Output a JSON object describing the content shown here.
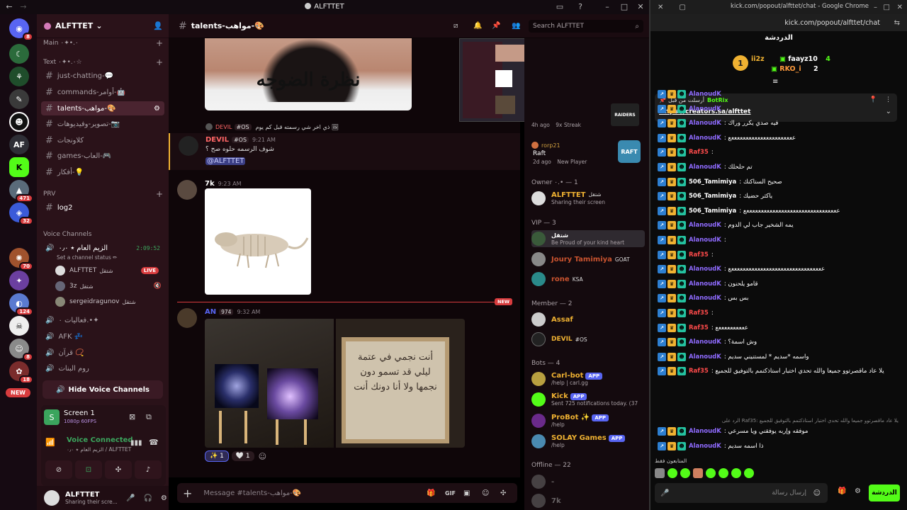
{
  "discord": {
    "window_title": "ALFTTET",
    "server_name": "ALFTTET",
    "guild_badges": [
      "8",
      "471",
      "32",
      "70",
      "124",
      "8",
      "18"
    ],
    "guild_letters": "AF",
    "new_label": "NEW",
    "categories": {
      "main": "Main ٠.•✦٠",
      "text": "Text ٠.•✦٠☆",
      "prv": "PRV",
      "voice": "Voice Channels"
    },
    "channels": [
      {
        "label": "just-chatting-💬"
      },
      {
        "label": "commands-أوامر-🤖"
      },
      {
        "label": "talents-مواهب-🎨"
      },
      {
        "label": "تصوير-وفيديوهات-📷"
      },
      {
        "label": "كلاونجات"
      },
      {
        "label": "games-العاب-🎮"
      },
      {
        "label": "أفكار-💡"
      }
    ],
    "prv_channel": "log2",
    "voice_channel": "الزيم العام ⭑ ۰٫٠",
    "voice_timer": "2:09:52",
    "set_status": "Set a channel status ✏",
    "voice_users": [
      "ALFTTET",
      "3z",
      "sergeidragunov"
    ],
    "voice_tags": [
      "شتقل",
      "شتقل",
      "شتقل"
    ],
    "live_label": "LIVE",
    "other_voice": [
      {
        "label": "فعاليات ٠.•✦"
      },
      {
        "label": "AFK 💤"
      },
      {
        "label": "قرآن 📿"
      },
      {
        "label": "روم البنات"
      }
    ],
    "hide_voice": "Hide Voice Channels",
    "screen_share": {
      "title": "Screen 1",
      "sub": "1080p 60FPS"
    },
    "voice_connected": {
      "title": "Voice Connected",
      "sub": "الزيم العام ⭑ ۰٫٠ / ALFTTET"
    },
    "user": {
      "name": "ALFTTET",
      "status": "Sharing their scre..."
    },
    "chat_channel": "talents-مواهب-🎨",
    "search_placeholder": "Search ALFTTET",
    "messages": {
      "meme_text": "نظرة الضوجه",
      "reply_name": "DEVIL",
      "reply_tag": "#OS",
      "reply_text": "ذي اخر شي رسمته قبل كم يوم 🖼",
      "m1_name": "DEVIL",
      "m1_tag": "#OS",
      "m1_time": "9:21 AM",
      "m1_text": "شوف الرسمه حلوه صح ؟",
      "m1_mention": "@ALFTTET",
      "m2_name": "7k",
      "m2_time": "9:23 AM",
      "m3_name": "AN",
      "m3_tag": "974",
      "m3_time": "9:32 AM",
      "new_label": "NEW",
      "art_text": "أنت نجمي في عتمة ليلي قد تسمو دون نجمها ولا أنا دونك أنت",
      "reaction_1": "✨ 1",
      "reaction_2": "🤍 1"
    },
    "composer_placeholder": "Message #talents-مواهب-🎨",
    "members": {
      "stream_meta_1": "4h ago",
      "stream_meta_2": "9x Streak",
      "activity_name": "rorp21",
      "activity_game": "Raft",
      "activity_meta_1": "2d ago",
      "activity_meta_2": "New Player",
      "owner_cat": "Owner ٠.• — 1",
      "owner_name": "ALFTTET",
      "owner_status": "Sharing their screen",
      "owner_tag": "شتقل",
      "vip_cat": "VIP — 3",
      "vip1_name": "شتقل",
      "vip1_status": "Be Proud of your kind heart",
      "vip2_name": "Joury Tamimiya",
      "vip2_tag": "GOAT",
      "vip3_name": "rone",
      "vip3_tag": "KSA",
      "member_cat": "Member — 2",
      "mem1_name": "Assaf",
      "mem2_name": "DEVIL",
      "mem2_tag": "#OS",
      "bots_cat": "Bots — 4",
      "bot1_name": "Carl-bot",
      "bot1_status": "/help | carl.gg",
      "bot2_name": "Kick",
      "bot2_status": "Sent 725 notifications today. (3755 yo",
      "bot3_name": "ProBot ✨",
      "bot3_status": "/help",
      "bot4_name": "SOLAY Games",
      "bot4_status": "/help",
      "app_label": "APP",
      "offline_cat": "Offline — 22",
      "off1_name": "-",
      "off2_name": "7k"
    }
  },
  "kick": {
    "window_title": "kick.com/popout/alfttet/chat - Google Chrome",
    "url": "kick.com/popout/alfttet/chat",
    "chat_title": "الدردشة",
    "leaders": [
      {
        "name": "ii2z",
        "score": ""
      },
      {
        "name": "faayz10",
        "score": "4"
      },
      {
        "name": "RKO_i",
        "score": "2"
      }
    ],
    "leader_rank": "1",
    "pinned_label": "أرسلت من قبل",
    "pinned_user": "BotRix",
    "pinned_link": "https://creators.sa/alfttet",
    "lines": [
      {
        "user": "AlanoudK",
        "text": "",
        "color": "#8f6bff"
      },
      {
        "user": "AlanoudK",
        "text": "",
        "color": "#8f6bff"
      },
      {
        "user": "AlanoudK",
        "text": ": فيه صدي يكرر وراك",
        "color": "#8f6bff"
      },
      {
        "user": "AlanoudK",
        "text": ": ععععععععععععععععععععععع",
        "color": "#8f6bff"
      },
      {
        "user": "Raf35",
        "text": ":",
        "color": "#ff4b4b"
      },
      {
        "user": "AlanoudK",
        "text": ": تم حلحلك",
        "color": "#8f6bff"
      },
      {
        "user": "506_Tamimiya",
        "text": ": صحيح الستاكنك",
        "color": "#ffffff"
      },
      {
        "user": "506_Tamimiya",
        "text": ": ياكثر حضيك",
        "color": "#ffffff"
      },
      {
        "user": "506_Tamimiya",
        "text": ": ععععععععععععععععععععععععععععععععع",
        "color": "#ffffff"
      },
      {
        "user": "AlanoudK",
        "text": ": يمه الشخير جاب لي الدوم",
        "color": "#8f6bff"
      },
      {
        "user": "AlanoudK",
        "text": ":",
        "color": "#8f6bff"
      },
      {
        "user": "Raf35",
        "text": ":",
        "color": "#ff4b4b"
      },
      {
        "user": "AlanoudK",
        "text": ": ععععععععععععععععععععععععععععععععع",
        "color": "#8f6bff"
      },
      {
        "user": "AlanoudK",
        "text": ": قامو يلحنون",
        "color": "#8f6bff"
      },
      {
        "user": "AlanoudK",
        "text": ": بس بس",
        "color": "#8f6bff"
      },
      {
        "user": "Raf35",
        "text": ":",
        "color": "#ff4b4b"
      },
      {
        "user": "Raf35",
        "text": ": ععععععععععع",
        "color": "#ff4b4b"
      },
      {
        "user": "AlanoudK",
        "text": ": وش اسمة؟",
        "color": "#8f6bff"
      },
      {
        "user": "AlanoudK",
        "text": ": واسمه *سديم * لمستنيني سديم",
        "color": "#8f6bff"
      },
      {
        "user": "Raf35",
        "text": ": يلا عاد ماقصرتوو جميعا والله تحدي اختبار استاذكتمم بالتوفيق للجميع",
        "color": "#ff4b4b"
      }
    ],
    "reply_ref": "الرد على Raf35: يلا عاد ماقصرتوو جميعا والله تحدي اختبار استاذكتمم بالتوفيق للجميع",
    "last_lines": [
      {
        "user": "AlanoudK",
        "text": ": موفقه وإربه يوفقني ويا مسرعي",
        "color": "#8f6bff"
      },
      {
        "user": "AlanoudK",
        "text": ": ذا اسمه سديم",
        "color": "#8f6bff"
      }
    ],
    "viewers_label": "المتابعون فقط",
    "send_placeholder": "إرسال رسالة",
    "chat_button": "الدردشة",
    "colors": {
      "green": "#53fc18",
      "bg": "#0b0b0b"
    }
  }
}
